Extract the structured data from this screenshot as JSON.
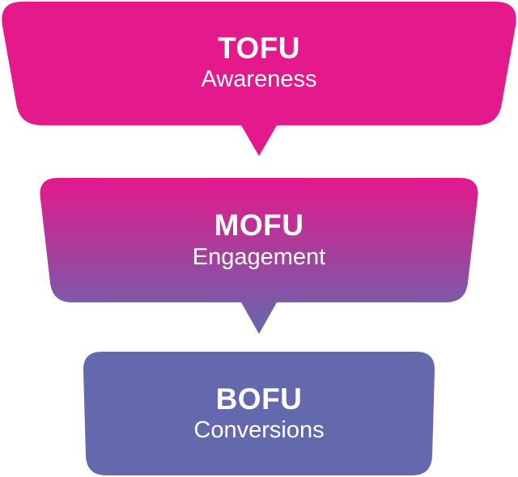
{
  "stages": [
    {
      "title": "TOFU",
      "subtitle": "Awareness"
    },
    {
      "title": "MOFU",
      "subtitle": "Engagement"
    },
    {
      "title": "BOFU",
      "subtitle": "Conversions"
    }
  ],
  "colors": {
    "top": "#E3198C",
    "bottom": "#6469AE",
    "text": "#FFFFFF"
  }
}
